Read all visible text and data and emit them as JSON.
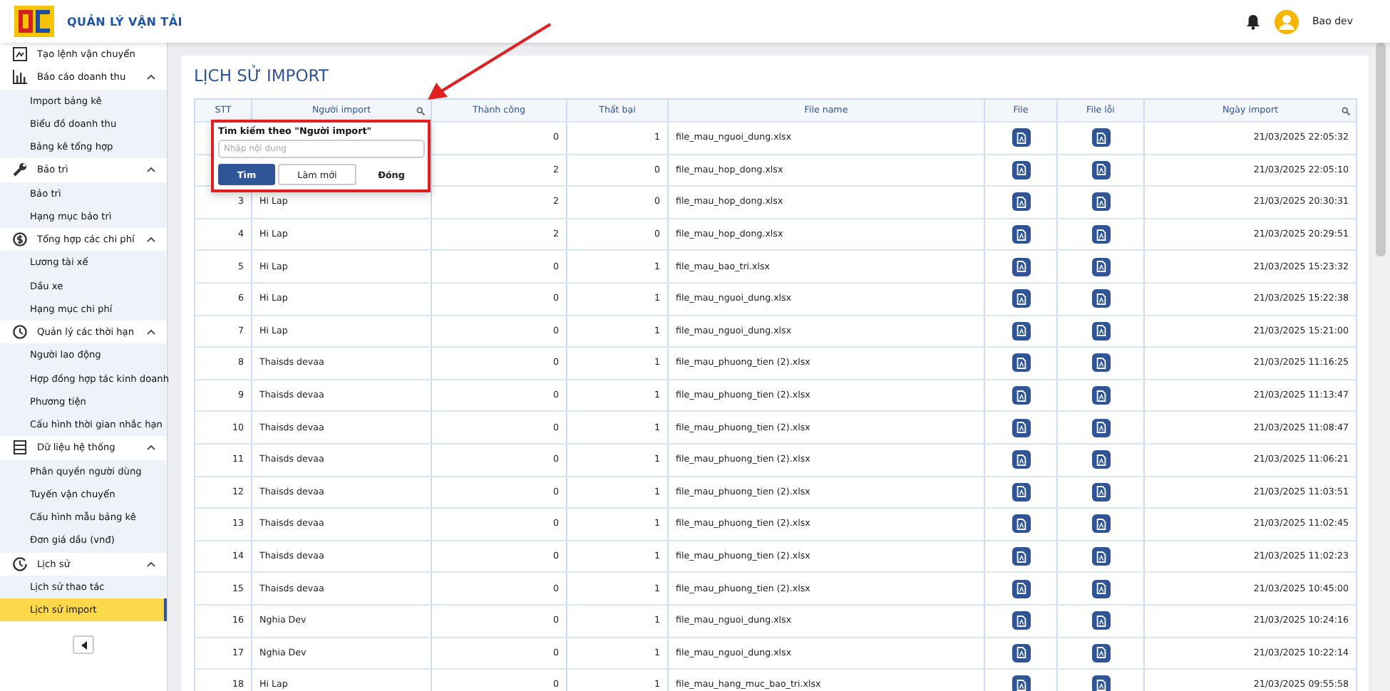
{
  "app": {
    "title": "QUẢN LÝ VẬN TẢI",
    "user": "Bao dev"
  },
  "sidebar": {
    "items": [
      {
        "label": "Tạo lệnh vận chuyển",
        "selected": false
      },
      {
        "label": "Báo cáo doanh thu",
        "expanded": true,
        "children": [
          {
            "label": "Import bảng kê",
            "selected": false
          },
          {
            "label": "Biểu đồ doanh thu",
            "selected": false
          },
          {
            "label": "Bảng kê tổng hợp",
            "selected": false
          }
        ]
      },
      {
        "label": "Bảo trì",
        "expanded": true,
        "children": [
          {
            "label": "Bảo trì",
            "selected": false
          },
          {
            "label": "Hạng mục bảo trì",
            "selected": false
          }
        ]
      },
      {
        "label": "Tổng hợp các chi phí",
        "expanded": true,
        "children": [
          {
            "label": "Lương tài xế",
            "selected": false
          },
          {
            "label": "Dầu xe",
            "selected": false
          },
          {
            "label": "Hạng mục chi phí",
            "selected": false
          }
        ]
      },
      {
        "label": "Quản lý các thời hạn",
        "expanded": true,
        "children": [
          {
            "label": "Người lao động",
            "selected": false
          },
          {
            "label": "Hợp đồng hợp tác kinh doanh",
            "selected": false
          },
          {
            "label": "Phương tiện",
            "selected": false
          },
          {
            "label": "Cấu hình thời gian nhắc hạn",
            "selected": false
          }
        ]
      },
      {
        "label": "Dữ liệu hệ thống",
        "expanded": true,
        "children": [
          {
            "label": "Phân quyền người dùng",
            "selected": false
          },
          {
            "label": "Tuyến vận chuyển",
            "selected": false
          },
          {
            "label": "Cấu hình mẫu bảng kê",
            "selected": false
          },
          {
            "label": "Đơn giá dầu (vnđ)",
            "selected": false
          }
        ]
      },
      {
        "label": "Lịch sử",
        "expanded": true,
        "children": [
          {
            "label": "Lịch sử thao tác",
            "selected": false
          },
          {
            "label": "Lịch sử import",
            "selected": true
          }
        ]
      }
    ]
  },
  "page": {
    "title": "LỊCH SỬ IMPORT"
  },
  "table": {
    "columns": [
      {
        "label": "STT",
        "searchable": false
      },
      {
        "label": "Người import",
        "searchable": true
      },
      {
        "label": "Thành công",
        "searchable": false
      },
      {
        "label": "Thất bại",
        "searchable": false
      },
      {
        "label": "File name",
        "searchable": false
      },
      {
        "label": "File",
        "searchable": false
      },
      {
        "label": "File lỗi",
        "searchable": false
      },
      {
        "label": "Ngày import",
        "searchable": true
      }
    ],
    "rows": [
      {
        "success": "0",
        "failed": "1",
        "file_name": "file_mau_nguoi_dung.xlsx",
        "date": "21/03/2025 22:05:32"
      },
      {
        "success": "2",
        "failed": "0",
        "file_name": "file_mau_hop_dong.xlsx",
        "date": "21/03/2025 22:05:10"
      },
      {
        "stt": "3",
        "user": "Hi Lap",
        "success": "2",
        "failed": "0",
        "file_name": "file_mau_hop_dong.xlsx",
        "date": "21/03/2025 20:30:31"
      },
      {
        "stt": "4",
        "user": "Hi Lap",
        "success": "2",
        "failed": "0",
        "file_name": "file_mau_hop_dong.xlsx",
        "date": "21/03/2025 20:29:51"
      },
      {
        "stt": "5",
        "user": "Hi Lap",
        "success": "0",
        "failed": "1",
        "file_name": "file_mau_bao_tri.xlsx",
        "date": "21/03/2025 15:23:32"
      },
      {
        "stt": "6",
        "user": "Hi Lap",
        "success": "0",
        "failed": "1",
        "file_name": "file_mau_nguoi_dung.xlsx",
        "date": "21/03/2025 15:22:38"
      },
      {
        "stt": "7",
        "user": "Hi Lap",
        "success": "0",
        "failed": "1",
        "file_name": "file_mau_nguoi_dung.xlsx",
        "date": "21/03/2025 15:21:00"
      },
      {
        "stt": "8",
        "user": "Thaisds devaa",
        "success": "0",
        "failed": "1",
        "file_name": "file_mau_phuong_tien (2).xlsx",
        "date": "21/03/2025 11:16:25"
      },
      {
        "stt": "9",
        "user": "Thaisds devaa",
        "success": "0",
        "failed": "1",
        "file_name": "file_mau_phuong_tien (2).xlsx",
        "date": "21/03/2025 11:13:47"
      },
      {
        "stt": "10",
        "user": "Thaisds devaa",
        "success": "0",
        "failed": "1",
        "file_name": "file_mau_phuong_tien (2).xlsx",
        "date": "21/03/2025 11:08:47"
      },
      {
        "stt": "11",
        "user": "Thaisds devaa",
        "success": "0",
        "failed": "1",
        "file_name": "file_mau_phuong_tien (2).xlsx",
        "date": "21/03/2025 11:06:21"
      },
      {
        "stt": "12",
        "user": "Thaisds devaa",
        "success": "0",
        "failed": "1",
        "file_name": "file_mau_phuong_tien (2).xlsx",
        "date": "21/03/2025 11:03:51"
      },
      {
        "stt": "13",
        "user": "Thaisds devaa",
        "success": "0",
        "failed": "1",
        "file_name": "file_mau_phuong_tien (2).xlsx",
        "date": "21/03/2025 11:02:45"
      },
      {
        "stt": "14",
        "user": "Thaisds devaa",
        "success": "0",
        "failed": "1",
        "file_name": "file_mau_phuong_tien (2).xlsx",
        "date": "21/03/2025 11:02:23"
      },
      {
        "stt": "15",
        "user": "Thaisds devaa",
        "success": "0",
        "failed": "1",
        "file_name": "file_mau_phuong_tien (2).xlsx",
        "date": "21/03/2025 10:45:00"
      },
      {
        "stt": "16",
        "user": "Nghia Dev",
        "success": "0",
        "failed": "1",
        "file_name": "file_mau_nguoi_dung.xlsx",
        "date": "21/03/2025 10:24:16"
      },
      {
        "stt": "17",
        "user": "Nghia Dev",
        "success": "0",
        "failed": "1",
        "file_name": "file_mau_nguoi_dung.xlsx",
        "date": "21/03/2025 10:22:14"
      },
      {
        "stt": "18",
        "user": "Hi Lap",
        "success": "0",
        "failed": "1",
        "file_name": "file_mau_hang_muc_bao_tri.xlsx",
        "date": "21/03/2025 09:55:58"
      }
    ]
  },
  "search_popup": {
    "title": "Tìm kiếm theo \"Người import\"",
    "placeholder": "Nhập nội dung",
    "buttons": [
      {
        "label": "Tìm",
        "kind": "primary"
      },
      {
        "label": "Làm mới",
        "kind": "outline"
      },
      {
        "label": "Đóng",
        "kind": "text"
      }
    ]
  }
}
